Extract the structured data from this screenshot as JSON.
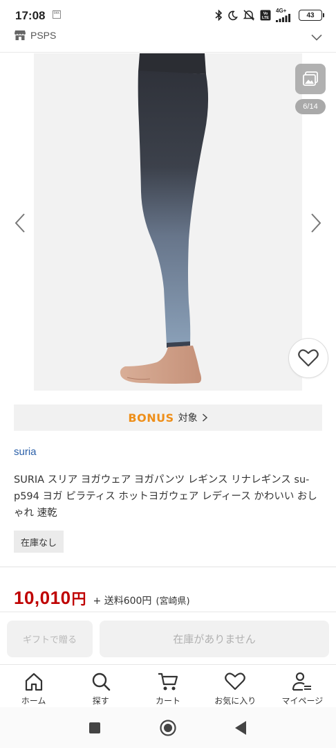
{
  "status_bar": {
    "time": "17:08",
    "small_icon": "BKK",
    "network_label": "4G+",
    "battery": "43",
    "icons": [
      "bluetooth-icon",
      "moon-icon",
      "mute-icon",
      "volte-icon",
      "signal-icon",
      "battery-icon"
    ]
  },
  "shop": {
    "name": "PSPS",
    "icon": "store-icon"
  },
  "gallery": {
    "counter": "6/14"
  },
  "bonus": {
    "logo": "BONUS",
    "label": "対象",
    "chevron": "›"
  },
  "product": {
    "brand": "suria",
    "title": "SURIA スリア ヨガウェア ヨガパンツ レギンス リナレギンス su-p594 ヨガ ピラティス ホットヨガウェア レディース かわいい おしゃれ 速乾",
    "stock": "在庫なし",
    "price": "10,010",
    "price_unit": "円",
    "shipping": "+ 送料600円",
    "shipping_region": "(宮崎県)"
  },
  "actions": {
    "gift_label": "ギフトで贈る",
    "cart_label": "在庫がありません"
  },
  "bottom_nav": {
    "items": [
      {
        "label": "ホーム",
        "icon": "home-icon"
      },
      {
        "label": "探す",
        "icon": "search-icon"
      },
      {
        "label": "カート",
        "icon": "cart-icon"
      },
      {
        "label": "お気に入り",
        "icon": "heart-icon"
      },
      {
        "label": "マイページ",
        "icon": "user-icon"
      }
    ]
  },
  "colors": {
    "price": "#bf0000",
    "bonus": "#ee8f1a",
    "brand_link": "#2a5fa8"
  }
}
